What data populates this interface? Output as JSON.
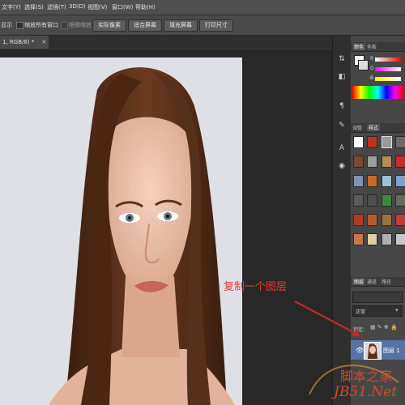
{
  "menubar": {
    "items": [
      "文字(Y)",
      "选择(S)",
      "滤镜(T)",
      "3D(D)",
      "视图(V)",
      "窗口(W)",
      "帮助(H)"
    ]
  },
  "options": {
    "show_label": "显示",
    "all_windows": "缩放所有窗口",
    "scrubby": "细微缩放",
    "actual_pixels": "实际像素",
    "fit_screen": "适合屏幕",
    "fill_screen": "填充屏幕",
    "print_size": "打印尺寸"
  },
  "document": {
    "tab_label": "1, RGB/8) *",
    "close": "×"
  },
  "panels": {
    "color_tab": "颜色",
    "swatches_tab": "色板",
    "channels": [
      "R",
      "G",
      "B"
    ],
    "adjust_tab": "调整",
    "styles_tab": "样式",
    "layers_tab": "图层",
    "channel_tab": "通道",
    "path_tab": "路径",
    "blend_mode": "正常",
    "lock_label": "锁定:",
    "layer_name": "图层 1"
  },
  "annotation": {
    "text": "复制一个图层"
  },
  "watermark": {
    "line1": "脚本之家",
    "line2": "JB51.Net"
  },
  "colors": {
    "annotation": "#e83a2f",
    "layer_selected": "#5773a5",
    "photo_bg": "#dfe0e5"
  }
}
